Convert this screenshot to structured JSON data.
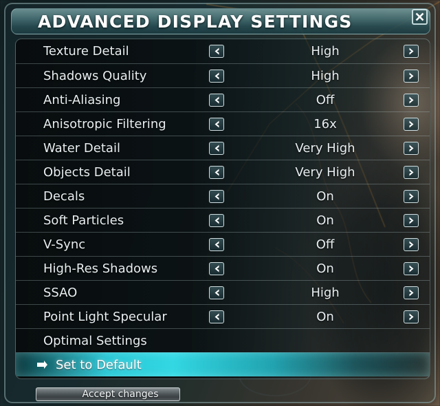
{
  "window": {
    "title": "ADVANCED DISPLAY SETTINGS",
    "close_icon": "close-x-icon",
    "accent_color": "#2ad6e6",
    "title_bar_color": "#4a7478",
    "panel_bg_color": "#0a1012"
  },
  "settings": {
    "left_arrow_icon": "chevron-left-icon",
    "right_arrow_icon": "chevron-right-icon",
    "rows": [
      {
        "label": "Texture Detail",
        "value": "High",
        "has_arrows": true
      },
      {
        "label": "Shadows Quality",
        "value": "High",
        "has_arrows": true
      },
      {
        "label": "Anti-Aliasing",
        "value": "Off",
        "has_arrows": true
      },
      {
        "label": "Anisotropic Filtering",
        "value": "16x",
        "has_arrows": true
      },
      {
        "label": "Water Detail",
        "value": "Very High",
        "has_arrows": true
      },
      {
        "label": "Objects Detail",
        "value": "Very High",
        "has_arrows": true
      },
      {
        "label": "Decals",
        "value": "On",
        "has_arrows": true
      },
      {
        "label": "Soft Particles",
        "value": "On",
        "has_arrows": true
      },
      {
        "label": "V-Sync",
        "value": "Off",
        "has_arrows": true
      },
      {
        "label": "High-Res Shadows",
        "value": "On",
        "has_arrows": true
      },
      {
        "label": "SSAO",
        "value": "High",
        "has_arrows": true
      },
      {
        "label": "Point Light Specular",
        "value": "On",
        "has_arrows": true
      },
      {
        "label": "Optimal Settings",
        "value": "",
        "has_arrows": false
      },
      {
        "label": "Set to Default",
        "value": "",
        "has_arrows": false,
        "selected": true
      }
    ]
  },
  "selection": {
    "marker_icon": "arrow-right-marker-icon"
  },
  "footer": {
    "accept_label": "Accept changes"
  }
}
